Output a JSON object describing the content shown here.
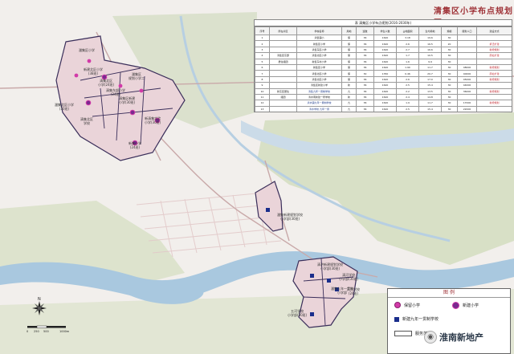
{
  "title": "清集区小学布点规划图",
  "table": {
    "caption": "表  清集区小学布点规划(2016-2030年)",
    "headers": [
      "序号",
      "所在片区",
      "学校名称",
      "用地",
      "班数",
      "学生人数",
      "占地面积",
      "生均用地",
      "规模",
      "服务人口",
      "建设方式"
    ],
    "rows": [
      [
        "1",
        "",
        "清集镇小",
        "保",
        "36",
        "1620",
        "3.18",
        "19.6",
        "30",
        "",
        ""
      ],
      [
        "2",
        "",
        "新集区小学",
        "保",
        "36",
        "1620",
        "2.6",
        "16.5",
        "20",
        "",
        "拆迁扩建"
      ],
      [
        "3",
        "",
        "清集东区小学",
        "保",
        "36",
        "1620",
        "2.7",
        "16.6",
        "30",
        "",
        "新增规划"
      ],
      [
        "4",
        "清集区东部",
        "清集北区小学",
        "保",
        "36",
        "1620",
        "1.7",
        "10.5",
        "30",
        "",
        "原址扩建"
      ],
      [
        "5",
        "居住组团",
        "新集东村小学",
        "保",
        "36",
        "1620",
        "1.6",
        "9.9",
        "30",
        "",
        ""
      ],
      [
        "6",
        "",
        "新集区小学",
        "保",
        "36",
        "1620",
        "1.90",
        "11.7",
        "30",
        "48000",
        "新增规划"
      ],
      [
        "7",
        "",
        "清集北区小学",
        "保",
        "30",
        "1350",
        "0.46",
        "20.7",
        "30",
        "40000",
        "原址扩建"
      ],
      [
        "8",
        "",
        "清集北区小学",
        "保",
        "36",
        "1620",
        "2.6",
        "17.0",
        "30",
        "45000",
        "新增规划"
      ],
      [
        "9",
        "",
        "清集区新建小学",
        "新",
        "36",
        "1620",
        "2.5",
        "15.4",
        "30",
        "44000",
        ""
      ],
      [
        "10",
        "新东区居住",
        "清集九年一贯制学校",
        "九",
        "36",
        "1620",
        "2.2",
        "13.5",
        "30",
        "36000",
        "新增规划"
      ],
      [
        "11",
        "组团",
        "清水南新建一所学校",
        "新",
        "36",
        "1620",
        "2.4",
        "14.8",
        "30",
        "",
        ""
      ],
      [
        "12",
        "",
        "清水镇九年一贯制学校",
        "九",
        "36",
        "1620",
        "1.9",
        "11.7",
        "30",
        "17000",
        "新增规划"
      ],
      [
        "13",
        "",
        "清水学校 九年一贯",
        "九",
        "36",
        "1620",
        "2.5",
        "15.4",
        "30",
        "22000",
        ""
      ],
      [
        "14",
        "",
        "清水学校",
        "九",
        "36",
        "1620",
        "2.4",
        "14.8",
        "30",
        "17000",
        "新增规划"
      ],
      [
        "15",
        "",
        "五河学校 九年一贯",
        "九",
        "36",
        "1620",
        "2.76",
        "17.0",
        "30",
        "17000",
        ""
      ]
    ]
  },
  "map_labels": {
    "a": "潘集区小学",
    "b": "新建北区小学\n(38班)",
    "c": "清集北区\n小学(24班)",
    "d": "潘集区\n规划小学二",
    "e": "清集东部小学\n(24班)",
    "f": "潘集北区小学\n(30班)",
    "g": "清集区新建\n小学(30班)",
    "h": "新清集实验\n小学(30班)",
    "i": "新集小学\n(24班)",
    "j": "清集北区\n学校",
    "k": "潘集新建规划学校\n小学部(30班)",
    "l": "清洪新建规划学校\n小学部(30班)",
    "m": "清河学校\n小学部(30班)",
    "n": "五河学校\n小学部(30班)",
    "o": "潘集九年一贯制\n小学部",
    "p": "天河学校\n(24班)"
  },
  "legend": {
    "title": "图  例",
    "keep": "保留小学",
    "new": "新建小学",
    "nine_year": "新建九年一贯制学校",
    "boundary": "服务范围"
  },
  "compass_letter": "N",
  "scale": {
    "labels": [
      "0",
      "250",
      "500",
      "1000m"
    ]
  },
  "watermark": "淮南新地产",
  "colors": {
    "river": "#a9c8df",
    "green": "#c9d8b3",
    "keep_school": "#d23aa8",
    "new_school": "#7a2a8f",
    "nine_year": "#1a2e8c",
    "title": "#9e3035"
  }
}
